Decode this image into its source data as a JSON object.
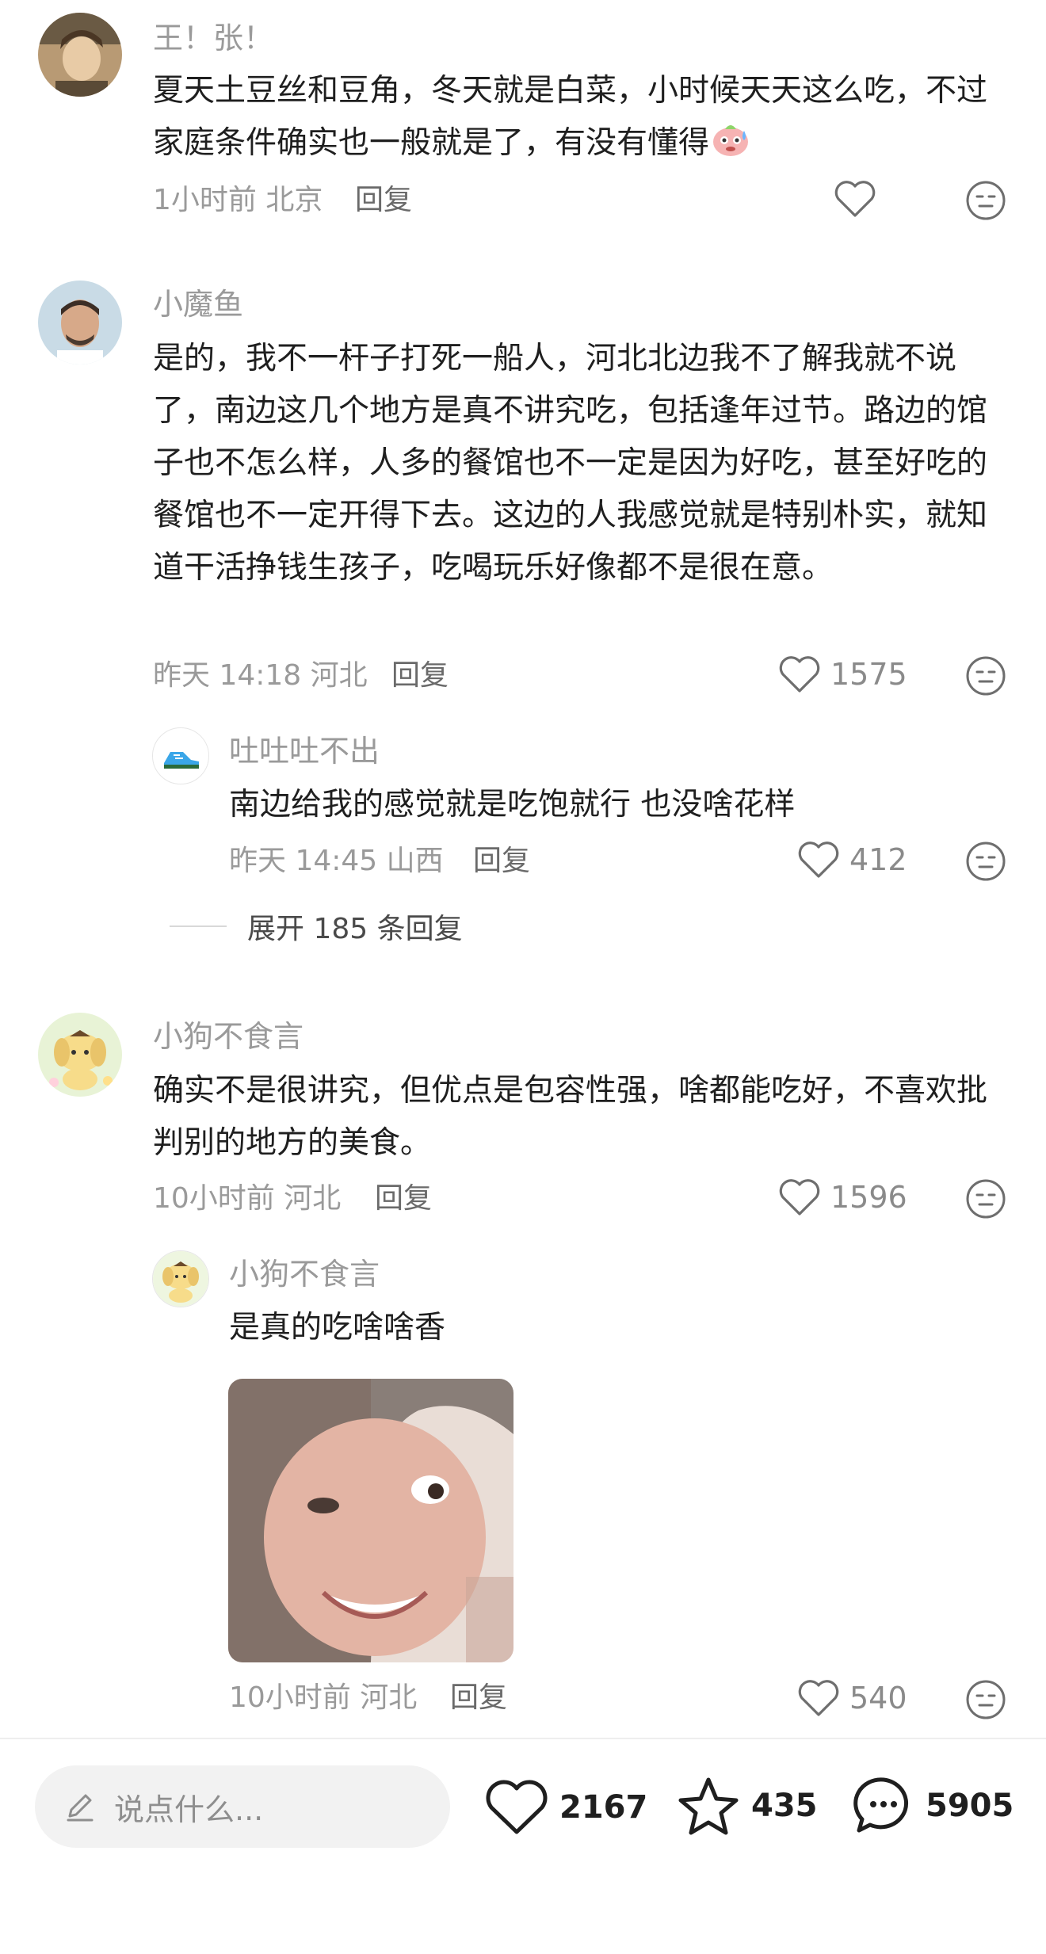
{
  "comments": [
    {
      "user": "王！张！",
      "body": "夏天土豆丝和豆角，冬天就是白菜，小时候天天这么吃，不过家庭条件确实也一般就是了，有没有懂得",
      "time": "1小时前",
      "location": "北京",
      "reply": "回复",
      "likes": "",
      "emoji": "sweating-face-emoji"
    },
    {
      "user": "小魔鱼",
      "body": "是的，我不一杆子打死一船人，河北北边我不了解我就不说了，南边这几个地方是真不讲究吃，包括逢年过节。路边的馆子也不怎么样，人多的餐馆也不一定是因为好吃，甚至好吃的餐馆也不一定开得下去。这边的人我感觉就是特别朴实，就知道干活挣钱生孩子，吃喝玩乐好像都不是很在意。",
      "time": "昨天 14:18",
      "location": "河北",
      "reply": "回复",
      "likes": "1575",
      "sub_reply": {
        "user": "吐吐吐不出",
        "body": "南边给我的感觉就是吃饱就行 也没啥花样",
        "time": "昨天 14:45",
        "location": "山西",
        "reply": "回复",
        "likes": "412"
      },
      "expand_label": "展开 185 条回复"
    },
    {
      "user": "小狗不食言",
      "body": "确实不是很讲究，但优点是包容性强，啥都能吃好，不喜欢批判别的地方的美食。",
      "time": "10小时前",
      "location": "河北",
      "reply": "回复",
      "likes": "1596",
      "sub_reply": {
        "user": "小狗不食言",
        "body": "是真的吃啥啥香",
        "time": "10小时前",
        "location": "河北",
        "reply": "回复",
        "likes": "540",
        "image": "smiling-face-meme-photo"
      }
    }
  ],
  "bottom_bar": {
    "input_placeholder": "说点什么...",
    "like_count": "2167",
    "favorite_count": "435",
    "comment_count": "5905"
  },
  "colors": {
    "text_primary": "#1f1f1f",
    "text_secondary": "#9a9a9a",
    "input_bg": "#f2f2f2"
  }
}
